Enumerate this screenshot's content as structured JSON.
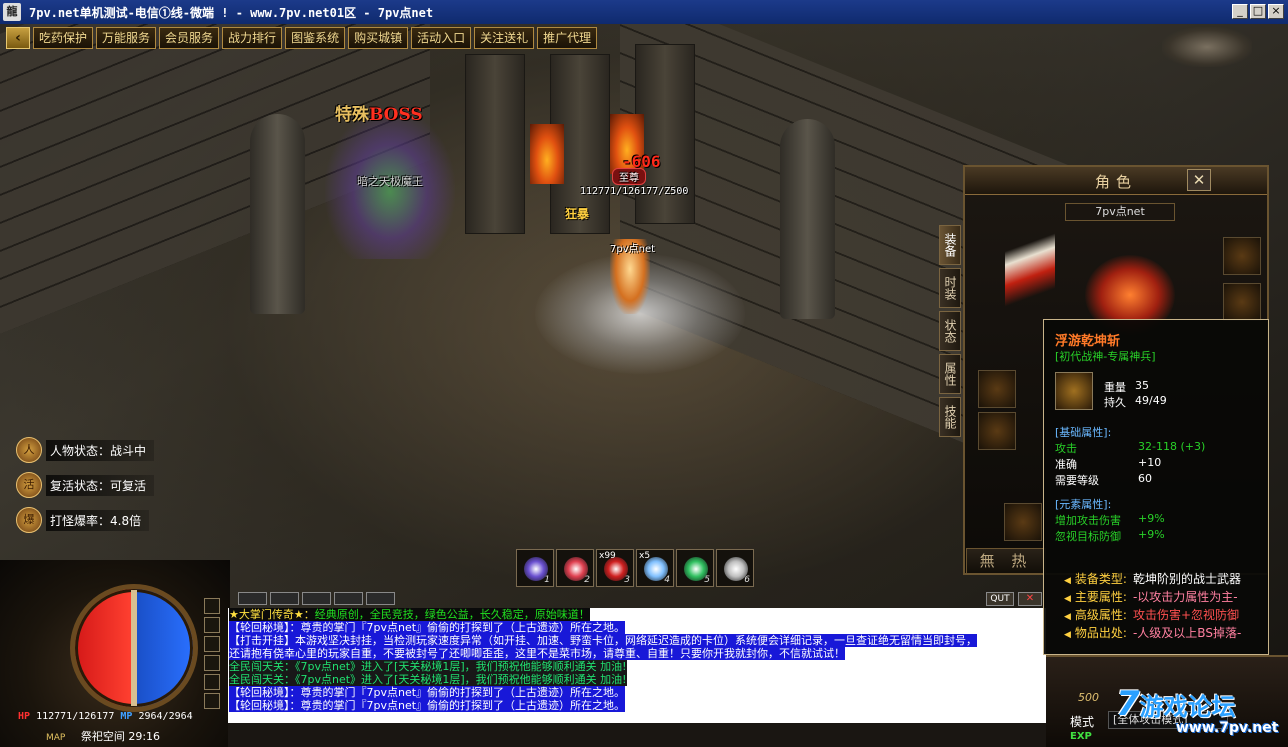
{
  "window": {
    "title": "7pv.net单机测试-电信①线-微端 ! - www.7pv.net01区 - 7pv点net",
    "app_icon": "龍",
    "buttons": [
      "_",
      "□",
      "×"
    ]
  },
  "top_menu": {
    "back_icon": "‹",
    "items": [
      "吃药保护",
      "万能服务",
      "会员服务",
      "战力排行",
      "图鉴系统",
      "购买城镇",
      "活动入口",
      "关注送礼",
      "推广代理"
    ]
  },
  "scene": {
    "boss_title_prefix": "特殊",
    "boss_title": "BOSS",
    "boss_name": "暗之天极魔王",
    "damage": "-606",
    "rank_badge": "至尊",
    "hero_hp": "112771/126177/Z500",
    "rage_label": "狂暴",
    "hero_name": "7pv点net"
  },
  "status": [
    {
      "icon": "person-icon",
      "glyph": "人",
      "text": "人物状态：战斗中"
    },
    {
      "icon": "revive-icon",
      "glyph": "活",
      "text": "复活状态：可复活"
    },
    {
      "icon": "drop-icon",
      "glyph": "爆",
      "text": "打怪爆率：4.8倍"
    }
  ],
  "hud": {
    "hp_label": "HP",
    "hp": "112771/126177",
    "mp_label": "MP",
    "mp": "2964/2964",
    "map_label": "MAP",
    "map": "祭祀空间 29:16",
    "hp_color": "#d41818",
    "mp_color": "#1a50c8"
  },
  "skillbar": [
    {
      "count": "",
      "key": "1",
      "color": "#6a50d0"
    },
    {
      "count": "",
      "key": "2",
      "color": "#e04050"
    },
    {
      "count": "x99",
      "key": "3",
      "color": "#d02020"
    },
    {
      "count": "x5",
      "key": "4",
      "color": "#80c0ff"
    },
    {
      "count": "",
      "key": "5",
      "color": "#30c060"
    },
    {
      "count": "",
      "key": "6",
      "color": "#c0c0c0"
    }
  ],
  "chat": {
    "lines": [
      {
        "style": "l0",
        "hl": "★大掌门传奇★：",
        "rest": "经典原创，全民竞技，绿色公益，长久稳定，原始味道！"
      },
      {
        "style": "blue",
        "text": "【轮回秘境】：尊贵的掌门『7pv点net』偷偷的打探到了（上古遗迹）所在之地。"
      },
      {
        "style": "blue",
        "text": "【打击开挂】本游戏坚决封挂，当检测玩家速度异常（如开挂、加速、野蛮卡位，网络延迟造成的卡位）系统便会详细记录，一旦查证绝无留情当即封号，"
      },
      {
        "style": "blue",
        "text": "还请抱有侥幸心里的玩家自重，不要被封号了还唧唧歪歪，这里不是菜市场，请尊重、自重！只要你开我就封你，不信就试试！"
      },
      {
        "style": "blk",
        "text": "全民闯天关：《7pv点net》进入了[天关秘境1层]，我们预祝他能够顺利通关 加油!"
      },
      {
        "style": "blk",
        "text": "全民闯天关：《7pv点net》进入了[天关秘境1层]，我们预祝他能够顺利通关 加油!"
      },
      {
        "style": "blue",
        "text": "【轮回秘境】：尊贵的掌门『7pv点net』偷偷的打探到了（上古遗迹）所在之地。"
      },
      {
        "style": "blue",
        "text": "【轮回秘境】：尊贵的掌门『7pv点net』偷偷的打探到了（上古遗迹）所在之地。"
      }
    ],
    "qut": "QUT",
    "close": "✕"
  },
  "char_panel": {
    "title": "角色",
    "close": "✕",
    "player_name": "7pv点net",
    "tabs": [
      "装备",
      "时装",
      "状态",
      "属性",
      "技能"
    ],
    "footer": "無 热"
  },
  "tooltip": {
    "name": "浮游乾坤斩",
    "subtitle": "[初代战神-专属神兵]",
    "weight_label": "重量",
    "weight": "35",
    "durability_label": "持久",
    "durability": "49/49",
    "base_header": "[基础属性]:",
    "attack_label": "攻击",
    "attack": "32-118 (+3)",
    "accuracy_label": "准确",
    "accuracy": "+10",
    "level_label": "需要等级",
    "level": "60",
    "element_header": "[元素属性]:",
    "elem1_label": "增加攻击伤害",
    "elem1": "+9%",
    "elem2_label": "忽视目标防御",
    "elem2": "+9%",
    "footer": [
      {
        "k": "装备类型:",
        "v": "乾坤阶别的战士武器",
        "c": ""
      },
      {
        "k": "主要属性:",
        "v": "-以攻击力属性为主-",
        "c": "pink"
      },
      {
        "k": "高级属性:",
        "v": "攻击伤害+忽视防御",
        "c": "red"
      },
      {
        "k": "物品出处:",
        "v": "-人级及以上BS掉落-",
        "c": "pink"
      }
    ]
  },
  "hud_right": {
    "num": "500",
    "mode_label": "模式",
    "mode_value": "[全体攻击模式]",
    "exp_label": "EXP"
  },
  "watermark": {
    "big": "7",
    "cn": "游戏论坛",
    "url": "www.7pv.net"
  }
}
